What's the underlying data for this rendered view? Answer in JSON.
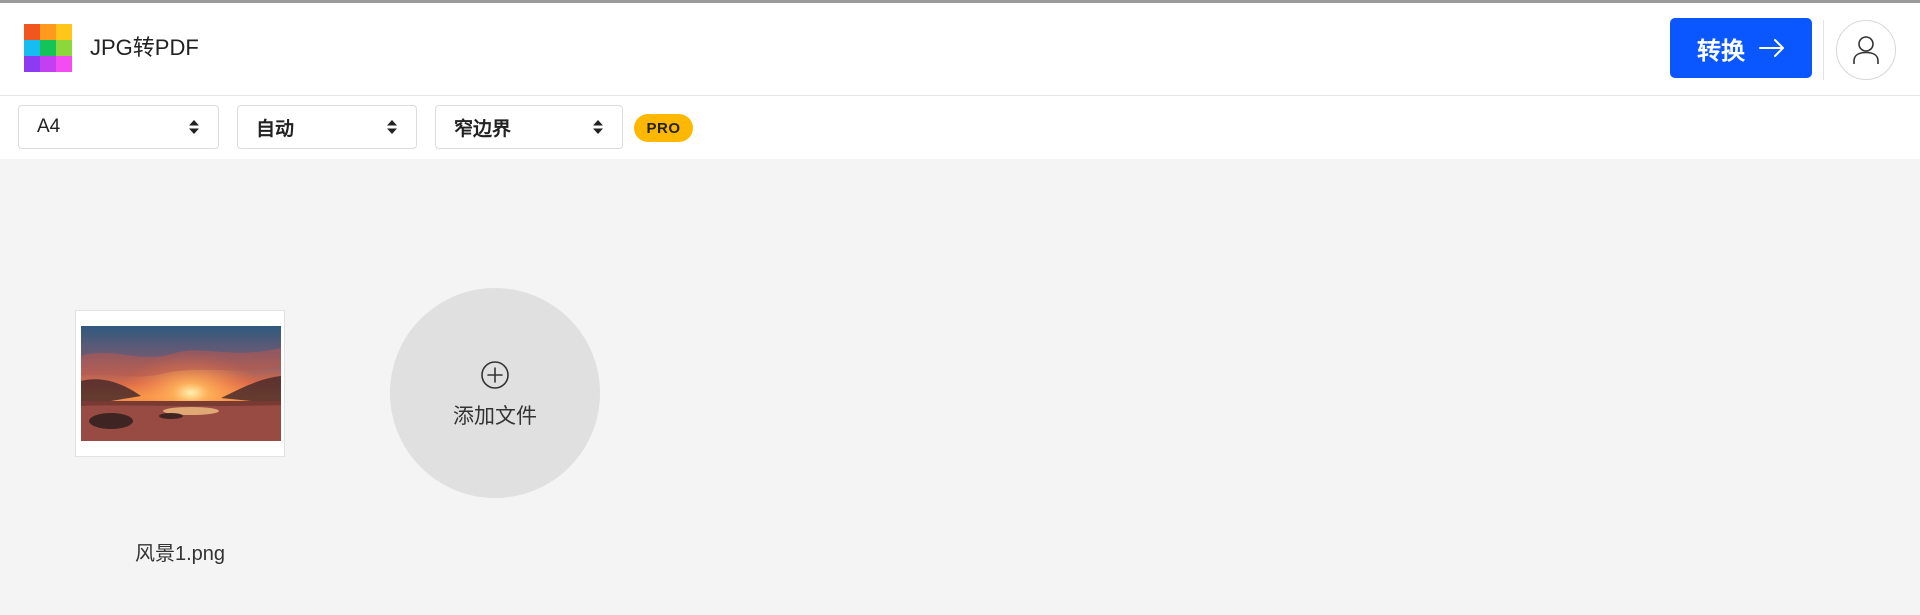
{
  "header": {
    "app_title": "JPG转PDF",
    "logo_colors": [
      "#f2551d",
      "#ff9a1f",
      "#ffc61a",
      "#16bdf0",
      "#15c459",
      "#8cd83a",
      "#8c3bf2",
      "#c23ff2",
      "#f24cf2"
    ],
    "convert_label": "转换",
    "accent_color": "#0a56ff",
    "user_icon": "user-icon"
  },
  "toolbar": {
    "page_size": "A4",
    "orientation": "自动",
    "margin": "窄边界",
    "pro_badge": "PRO",
    "pro_color": "#ffb800"
  },
  "files": [
    {
      "name": "风景1.png",
      "thumbnail": "sunset-landscape"
    }
  ],
  "add_file": {
    "label": "添加文件",
    "icon": "plus-circle-icon"
  }
}
